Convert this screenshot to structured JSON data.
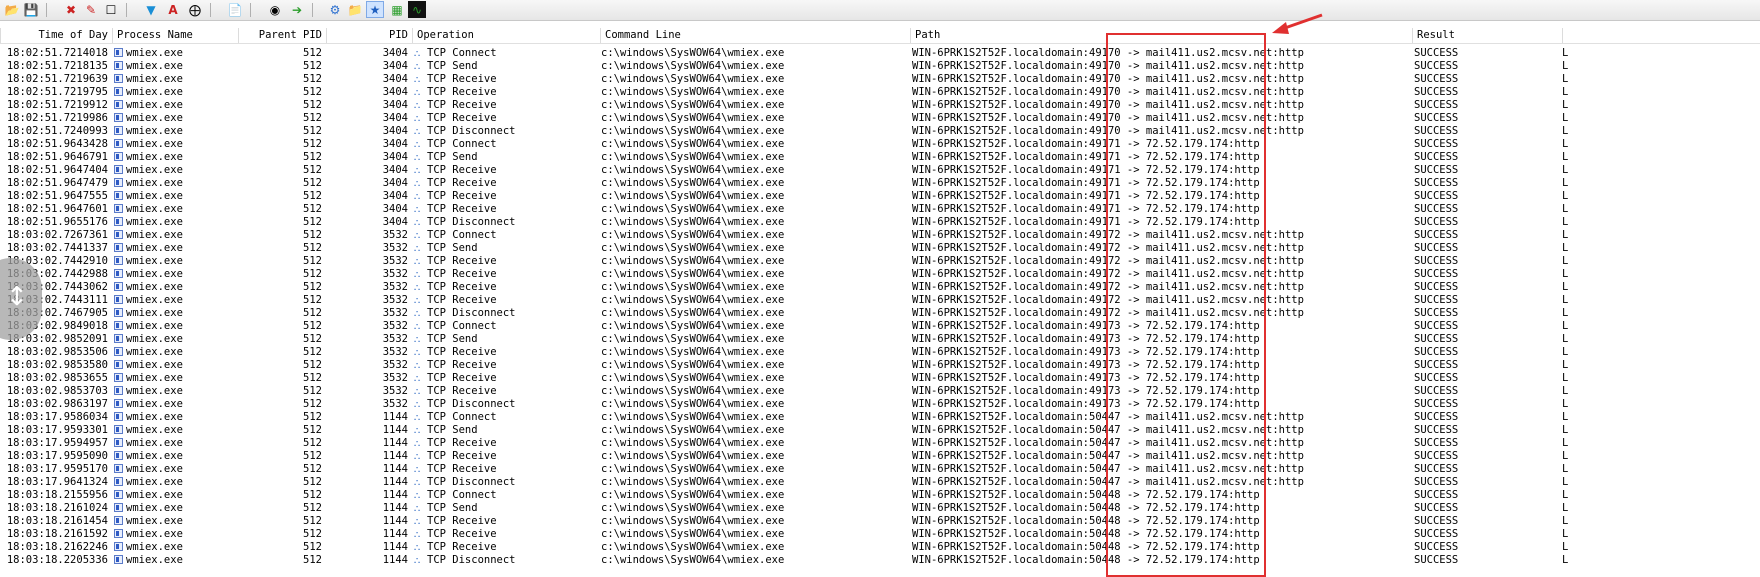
{
  "toolbar": {
    "buttons": [
      "open-icon",
      "save-icon",
      "autoscroll-icon",
      "clear-icon",
      "edit-filter-icon",
      "highlight-icon",
      "fonts-icon",
      "target-icon",
      "properties-icon",
      "find-icon",
      "jump-icon",
      "registry-icon",
      "filesystem-icon",
      "network-icon",
      "process-icon",
      "profiling-icon"
    ]
  },
  "columns": {
    "time": "Time of Day",
    "process": "Process Name",
    "ppid": "Parent PID",
    "pid": "PID",
    "operation": "Operation",
    "command": "Command Line",
    "path": "Path",
    "result": "Result"
  },
  "accent_color": "#e03030",
  "rows": [
    {
      "time": "18:02:51.7214018",
      "process": "wmiex.exe",
      "ppid": "512",
      "pid": "3404",
      "op": "TCP Connect",
      "cmd": "c:\\windows\\SysWOW64\\wmiex.exe",
      "path": "WIN-6PRK1S2T52F.localdomain:49170 -> mail411.us2.mcsv.net:http",
      "result": "SUCCESS"
    },
    {
      "time": "18:02:51.7218135",
      "process": "wmiex.exe",
      "ppid": "512",
      "pid": "3404",
      "op": "TCP Send",
      "cmd": "c:\\windows\\SysWOW64\\wmiex.exe",
      "path": "WIN-6PRK1S2T52F.localdomain:49170 -> mail411.us2.mcsv.net:http",
      "result": "SUCCESS"
    },
    {
      "time": "18:02:51.7219639",
      "process": "wmiex.exe",
      "ppid": "512",
      "pid": "3404",
      "op": "TCP Receive",
      "cmd": "c:\\windows\\SysWOW64\\wmiex.exe",
      "path": "WIN-6PRK1S2T52F.localdomain:49170 -> mail411.us2.mcsv.net:http",
      "result": "SUCCESS"
    },
    {
      "time": "18:02:51.7219795",
      "process": "wmiex.exe",
      "ppid": "512",
      "pid": "3404",
      "op": "TCP Receive",
      "cmd": "c:\\windows\\SysWOW64\\wmiex.exe",
      "path": "WIN-6PRK1S2T52F.localdomain:49170 -> mail411.us2.mcsv.net:http",
      "result": "SUCCESS"
    },
    {
      "time": "18:02:51.7219912",
      "process": "wmiex.exe",
      "ppid": "512",
      "pid": "3404",
      "op": "TCP Receive",
      "cmd": "c:\\windows\\SysWOW64\\wmiex.exe",
      "path": "WIN-6PRK1S2T52F.localdomain:49170 -> mail411.us2.mcsv.net:http",
      "result": "SUCCESS"
    },
    {
      "time": "18:02:51.7219986",
      "process": "wmiex.exe",
      "ppid": "512",
      "pid": "3404",
      "op": "TCP Receive",
      "cmd": "c:\\windows\\SysWOW64\\wmiex.exe",
      "path": "WIN-6PRK1S2T52F.localdomain:49170 -> mail411.us2.mcsv.net:http",
      "result": "SUCCESS"
    },
    {
      "time": "18:02:51.7240993",
      "process": "wmiex.exe",
      "ppid": "512",
      "pid": "3404",
      "op": "TCP Disconnect",
      "cmd": "c:\\windows\\SysWOW64\\wmiex.exe",
      "path": "WIN-6PRK1S2T52F.localdomain:49170 -> mail411.us2.mcsv.net:http",
      "result": "SUCCESS"
    },
    {
      "time": "18:02:51.9643428",
      "process": "wmiex.exe",
      "ppid": "512",
      "pid": "3404",
      "op": "TCP Connect",
      "cmd": "c:\\windows\\SysWOW64\\wmiex.exe",
      "path": "WIN-6PRK1S2T52F.localdomain:49171 -> 72.52.179.174:http",
      "result": "SUCCESS"
    },
    {
      "time": "18:02:51.9646791",
      "process": "wmiex.exe",
      "ppid": "512",
      "pid": "3404",
      "op": "TCP Send",
      "cmd": "c:\\windows\\SysWOW64\\wmiex.exe",
      "path": "WIN-6PRK1S2T52F.localdomain:49171 -> 72.52.179.174:http",
      "result": "SUCCESS"
    },
    {
      "time": "18:02:51.9647404",
      "process": "wmiex.exe",
      "ppid": "512",
      "pid": "3404",
      "op": "TCP Receive",
      "cmd": "c:\\windows\\SysWOW64\\wmiex.exe",
      "path": "WIN-6PRK1S2T52F.localdomain:49171 -> 72.52.179.174:http",
      "result": "SUCCESS"
    },
    {
      "time": "18:02:51.9647479",
      "process": "wmiex.exe",
      "ppid": "512",
      "pid": "3404",
      "op": "TCP Receive",
      "cmd": "c:\\windows\\SysWOW64\\wmiex.exe",
      "path": "WIN-6PRK1S2T52F.localdomain:49171 -> 72.52.179.174:http",
      "result": "SUCCESS"
    },
    {
      "time": "18:02:51.9647555",
      "process": "wmiex.exe",
      "ppid": "512",
      "pid": "3404",
      "op": "TCP Receive",
      "cmd": "c:\\windows\\SysWOW64\\wmiex.exe",
      "path": "WIN-6PRK1S2T52F.localdomain:49171 -> 72.52.179.174:http",
      "result": "SUCCESS"
    },
    {
      "time": "18:02:51.9647601",
      "process": "wmiex.exe",
      "ppid": "512",
      "pid": "3404",
      "op": "TCP Receive",
      "cmd": "c:\\windows\\SysWOW64\\wmiex.exe",
      "path": "WIN-6PRK1S2T52F.localdomain:49171 -> 72.52.179.174:http",
      "result": "SUCCESS"
    },
    {
      "time": "18:02:51.9655176",
      "process": "wmiex.exe",
      "ppid": "512",
      "pid": "3404",
      "op": "TCP Disconnect",
      "cmd": "c:\\windows\\SysWOW64\\wmiex.exe",
      "path": "WIN-6PRK1S2T52F.localdomain:49171 -> 72.52.179.174:http",
      "result": "SUCCESS"
    },
    {
      "time": "18:03:02.7267361",
      "process": "wmiex.exe",
      "ppid": "512",
      "pid": "3532",
      "op": "TCP Connect",
      "cmd": "c:\\windows\\SysWOW64\\wmiex.exe",
      "path": "WIN-6PRK1S2T52F.localdomain:49172 -> mail411.us2.mcsv.net:http",
      "result": "SUCCESS"
    },
    {
      "time": "18:03:02.7441337",
      "process": "wmiex.exe",
      "ppid": "512",
      "pid": "3532",
      "op": "TCP Send",
      "cmd": "c:\\windows\\SysWOW64\\wmiex.exe",
      "path": "WIN-6PRK1S2T52F.localdomain:49172 -> mail411.us2.mcsv.net:http",
      "result": "SUCCESS"
    },
    {
      "time": "18:03:02.7442910",
      "process": "wmiex.exe",
      "ppid": "512",
      "pid": "3532",
      "op": "TCP Receive",
      "cmd": "c:\\windows\\SysWOW64\\wmiex.exe",
      "path": "WIN-6PRK1S2T52F.localdomain:49172 -> mail411.us2.mcsv.net:http",
      "result": "SUCCESS"
    },
    {
      "time": "18:03:02.7442988",
      "process": "wmiex.exe",
      "ppid": "512",
      "pid": "3532",
      "op": "TCP Receive",
      "cmd": "c:\\windows\\SysWOW64\\wmiex.exe",
      "path": "WIN-6PRK1S2T52F.localdomain:49172 -> mail411.us2.mcsv.net:http",
      "result": "SUCCESS"
    },
    {
      "time": "18:03:02.7443062",
      "process": "wmiex.exe",
      "ppid": "512",
      "pid": "3532",
      "op": "TCP Receive",
      "cmd": "c:\\windows\\SysWOW64\\wmiex.exe",
      "path": "WIN-6PRK1S2T52F.localdomain:49172 -> mail411.us2.mcsv.net:http",
      "result": "SUCCESS"
    },
    {
      "time": "18:03:02.7443111",
      "process": "wmiex.exe",
      "ppid": "512",
      "pid": "3532",
      "op": "TCP Receive",
      "cmd": "c:\\windows\\SysWOW64\\wmiex.exe",
      "path": "WIN-6PRK1S2T52F.localdomain:49172 -> mail411.us2.mcsv.net:http",
      "result": "SUCCESS"
    },
    {
      "time": "18:03:02.7467905",
      "process": "wmiex.exe",
      "ppid": "512",
      "pid": "3532",
      "op": "TCP Disconnect",
      "cmd": "c:\\windows\\SysWOW64\\wmiex.exe",
      "path": "WIN-6PRK1S2T52F.localdomain:49172 -> mail411.us2.mcsv.net:http",
      "result": "SUCCESS"
    },
    {
      "time": "18:03:02.9849018",
      "process": "wmiex.exe",
      "ppid": "512",
      "pid": "3532",
      "op": "TCP Connect",
      "cmd": "c:\\windows\\SysWOW64\\wmiex.exe",
      "path": "WIN-6PRK1S2T52F.localdomain:49173 -> 72.52.179.174:http",
      "result": "SUCCESS"
    },
    {
      "time": "18:03:02.9852091",
      "process": "wmiex.exe",
      "ppid": "512",
      "pid": "3532",
      "op": "TCP Send",
      "cmd": "c:\\windows\\SysWOW64\\wmiex.exe",
      "path": "WIN-6PRK1S2T52F.localdomain:49173 -> 72.52.179.174:http",
      "result": "SUCCESS"
    },
    {
      "time": "18:03:02.9853506",
      "process": "wmiex.exe",
      "ppid": "512",
      "pid": "3532",
      "op": "TCP Receive",
      "cmd": "c:\\windows\\SysWOW64\\wmiex.exe",
      "path": "WIN-6PRK1S2T52F.localdomain:49173 -> 72.52.179.174:http",
      "result": "SUCCESS"
    },
    {
      "time": "18:03:02.9853580",
      "process": "wmiex.exe",
      "ppid": "512",
      "pid": "3532",
      "op": "TCP Receive",
      "cmd": "c:\\windows\\SysWOW64\\wmiex.exe",
      "path": "WIN-6PRK1S2T52F.localdomain:49173 -> 72.52.179.174:http",
      "result": "SUCCESS"
    },
    {
      "time": "18:03:02.9853655",
      "process": "wmiex.exe",
      "ppid": "512",
      "pid": "3532",
      "op": "TCP Receive",
      "cmd": "c:\\windows\\SysWOW64\\wmiex.exe",
      "path": "WIN-6PRK1S2T52F.localdomain:49173 -> 72.52.179.174:http",
      "result": "SUCCESS"
    },
    {
      "time": "18:03:02.9853703",
      "process": "wmiex.exe",
      "ppid": "512",
      "pid": "3532",
      "op": "TCP Receive",
      "cmd": "c:\\windows\\SysWOW64\\wmiex.exe",
      "path": "WIN-6PRK1S2T52F.localdomain:49173 -> 72.52.179.174:http",
      "result": "SUCCESS"
    },
    {
      "time": "18:03:02.9863197",
      "process": "wmiex.exe",
      "ppid": "512",
      "pid": "3532",
      "op": "TCP Disconnect",
      "cmd": "c:\\windows\\SysWOW64\\wmiex.exe",
      "path": "WIN-6PRK1S2T52F.localdomain:49173 -> 72.52.179.174:http",
      "result": "SUCCESS"
    },
    {
      "time": "18:03:17.9586034",
      "process": "wmiex.exe",
      "ppid": "512",
      "pid": "1144",
      "op": "TCP Connect",
      "cmd": "c:\\windows\\SysWOW64\\wmiex.exe",
      "path": "WIN-6PRK1S2T52F.localdomain:50447 -> mail411.us2.mcsv.net:http",
      "result": "SUCCESS"
    },
    {
      "time": "18:03:17.9593301",
      "process": "wmiex.exe",
      "ppid": "512",
      "pid": "1144",
      "op": "TCP Send",
      "cmd": "c:\\windows\\SysWOW64\\wmiex.exe",
      "path": "WIN-6PRK1S2T52F.localdomain:50447 -> mail411.us2.mcsv.net:http",
      "result": "SUCCESS"
    },
    {
      "time": "18:03:17.9594957",
      "process": "wmiex.exe",
      "ppid": "512",
      "pid": "1144",
      "op": "TCP Receive",
      "cmd": "c:\\windows\\SysWOW64\\wmiex.exe",
      "path": "WIN-6PRK1S2T52F.localdomain:50447 -> mail411.us2.mcsv.net:http",
      "result": "SUCCESS"
    },
    {
      "time": "18:03:17.9595090",
      "process": "wmiex.exe",
      "ppid": "512",
      "pid": "1144",
      "op": "TCP Receive",
      "cmd": "c:\\windows\\SysWOW64\\wmiex.exe",
      "path": "WIN-6PRK1S2T52F.localdomain:50447 -> mail411.us2.mcsv.net:http",
      "result": "SUCCESS"
    },
    {
      "time": "18:03:17.9595170",
      "process": "wmiex.exe",
      "ppid": "512",
      "pid": "1144",
      "op": "TCP Receive",
      "cmd": "c:\\windows\\SysWOW64\\wmiex.exe",
      "path": "WIN-6PRK1S2T52F.localdomain:50447 -> mail411.us2.mcsv.net:http",
      "result": "SUCCESS"
    },
    {
      "time": "18:03:17.9641324",
      "process": "wmiex.exe",
      "ppid": "512",
      "pid": "1144",
      "op": "TCP Disconnect",
      "cmd": "c:\\windows\\SysWOW64\\wmiex.exe",
      "path": "WIN-6PRK1S2T52F.localdomain:50447 -> mail411.us2.mcsv.net:http",
      "result": "SUCCESS"
    },
    {
      "time": "18:03:18.2155956",
      "process": "wmiex.exe",
      "ppid": "512",
      "pid": "1144",
      "op": "TCP Connect",
      "cmd": "c:\\windows\\SysWOW64\\wmiex.exe",
      "path": "WIN-6PRK1S2T52F.localdomain:50448 -> 72.52.179.174:http",
      "result": "SUCCESS"
    },
    {
      "time": "18:03:18.2161024",
      "process": "wmiex.exe",
      "ppid": "512",
      "pid": "1144",
      "op": "TCP Send",
      "cmd": "c:\\windows\\SysWOW64\\wmiex.exe",
      "path": "WIN-6PRK1S2T52F.localdomain:50448 -> 72.52.179.174:http",
      "result": "SUCCESS"
    },
    {
      "time": "18:03:18.2161454",
      "process": "wmiex.exe",
      "ppid": "512",
      "pid": "1144",
      "op": "TCP Receive",
      "cmd": "c:\\windows\\SysWOW64\\wmiex.exe",
      "path": "WIN-6PRK1S2T52F.localdomain:50448 -> 72.52.179.174:http",
      "result": "SUCCESS"
    },
    {
      "time": "18:03:18.2161592",
      "process": "wmiex.exe",
      "ppid": "512",
      "pid": "1144",
      "op": "TCP Receive",
      "cmd": "c:\\windows\\SysWOW64\\wmiex.exe",
      "path": "WIN-6PRK1S2T52F.localdomain:50448 -> 72.52.179.174:http",
      "result": "SUCCESS"
    },
    {
      "time": "18:03:18.2162246",
      "process": "wmiex.exe",
      "ppid": "512",
      "pid": "1144",
      "op": "TCP Receive",
      "cmd": "c:\\windows\\SysWOW64\\wmiex.exe",
      "path": "WIN-6PRK1S2T52F.localdomain:50448 -> 72.52.179.174:http",
      "result": "SUCCESS"
    },
    {
      "time": "18:03:18.2205336",
      "process": "wmiex.exe",
      "ppid": "512",
      "pid": "1144",
      "op": "TCP Disconnect",
      "cmd": "c:\\windows\\SysWOW64\\wmiex.exe",
      "path": "WIN-6PRK1S2T52F.localdomain:50448 -> 72.52.179.174:http",
      "result": "SUCCESS"
    }
  ]
}
